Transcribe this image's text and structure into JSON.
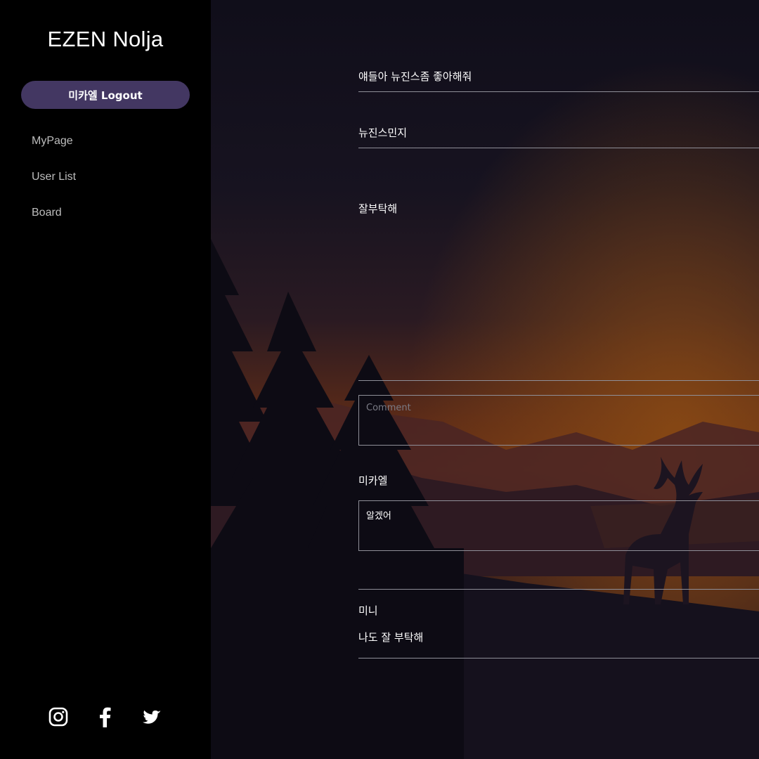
{
  "sidebar": {
    "brand": "EZEN Nolja",
    "logout_label": "미카엘 Logout",
    "nav": [
      "MyPage",
      "User List",
      "Board"
    ],
    "socials": [
      "instagram-icon",
      "facebook-icon",
      "twitter-icon"
    ]
  },
  "post": {
    "title": "얘들아 뉴진스좀 좋아해줘",
    "author": "뉴진스민지",
    "body": "잘부탁해"
  },
  "comment_form": {
    "placeholder": "Comment"
  },
  "comments": [
    {
      "author": "미카엘",
      "text": "알겠어"
    },
    {
      "author": "미니",
      "text": "나도 잘 부탁해"
    }
  ],
  "colors": {
    "sidebar_bg": "#000000",
    "logout_bg": "#433762",
    "sky_glow": "#7a3a12",
    "divider": "#8f8f98"
  }
}
